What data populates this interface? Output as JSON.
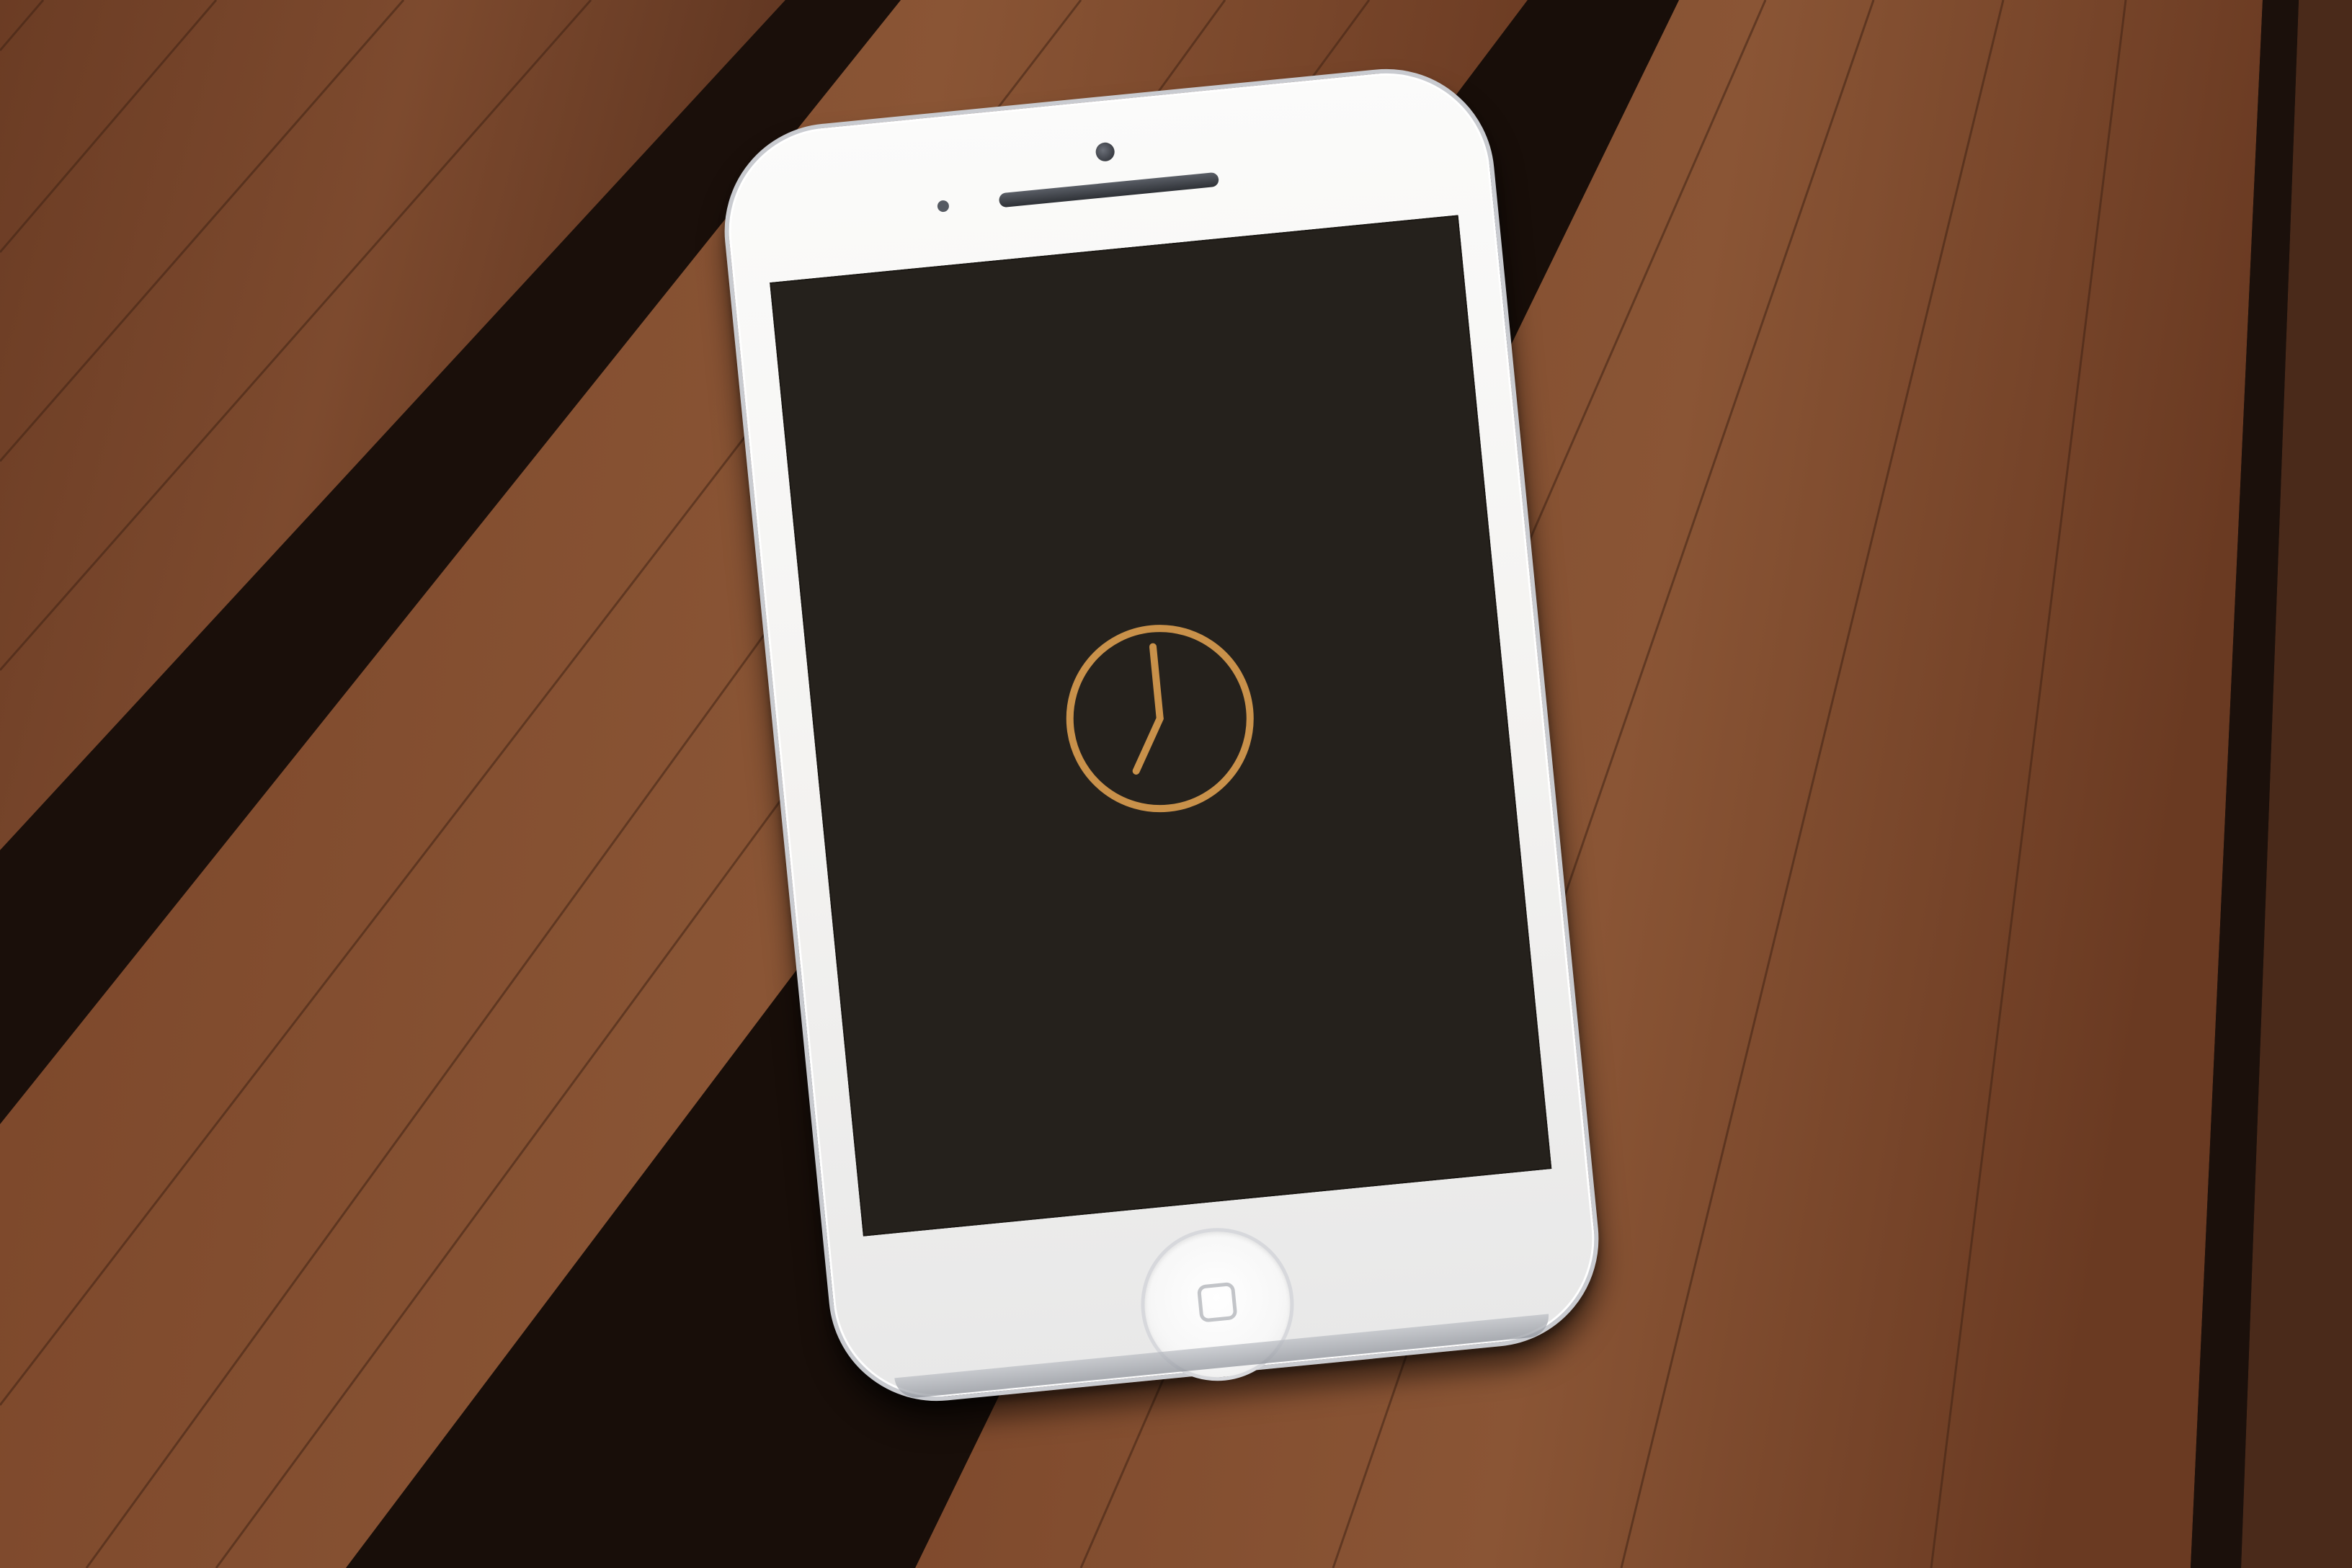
{
  "screen": {
    "background_color": "#25211c"
  },
  "clock": {
    "icon": "clock-icon",
    "color": "#c9914a",
    "hour_hand_hours": 7,
    "minute_hand_minutes": 0
  }
}
